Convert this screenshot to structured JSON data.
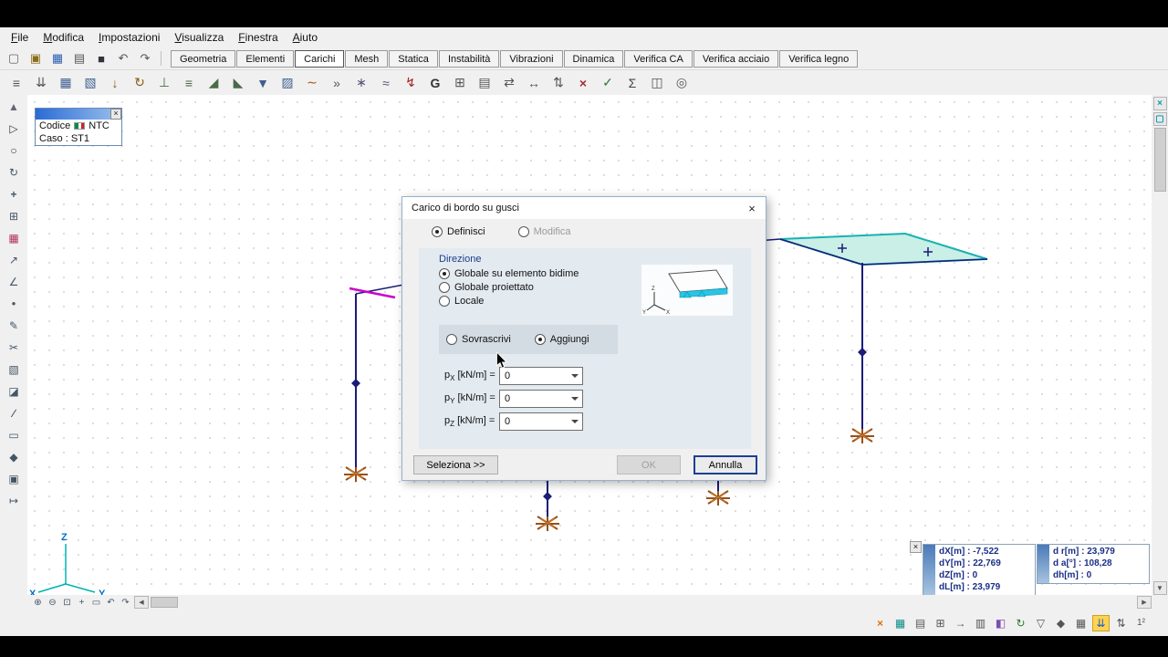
{
  "menu": {
    "items": [
      "File",
      "Modifica",
      "Impostazioni",
      "Visualizza",
      "Finestra",
      "Aiuto"
    ]
  },
  "toolbar1": {
    "icons": [
      {
        "name": "new-document-icon",
        "glyph": "▢",
        "style": "color:#666"
      },
      {
        "name": "open-folder-icon",
        "glyph": "▣",
        "style": "color:#8a6d1a"
      },
      {
        "name": "save-icon",
        "glyph": "▦",
        "style": "color:#2b5fb0"
      },
      {
        "name": "print-icon",
        "glyph": "▤",
        "style": "color:#555"
      },
      {
        "name": "snapshot-icon",
        "glyph": "■",
        "style": "color:#30343a"
      },
      {
        "name": "undo-icon",
        "glyph": "↶",
        "style": "color:#555"
      },
      {
        "name": "redo-icon",
        "glyph": "↷",
        "style": "color:#555"
      }
    ]
  },
  "tabs": [
    {
      "label": "Geometria"
    },
    {
      "label": "Elementi"
    },
    {
      "label": "Carichi",
      "active": true
    },
    {
      "label": "Mesh"
    },
    {
      "label": "Statica"
    },
    {
      "label": "Instabilità"
    },
    {
      "label": "Vibrazioni"
    },
    {
      "label": "Dinamica"
    },
    {
      "label": "Verifica CA"
    },
    {
      "label": "Verifica acciaio"
    },
    {
      "label": "Verifica legno"
    }
  ],
  "toolbar2": {
    "icons": [
      {
        "name": "load-list-icon",
        "glyph": "≡",
        "style": "color:#555"
      },
      {
        "name": "load-group-icon",
        "glyph": "⇊",
        "style": "color:#555"
      },
      {
        "name": "edge-load-icon",
        "glyph": "▦",
        "style": "color:#3f5f8f"
      },
      {
        "name": "surface-load-icon",
        "glyph": "▧",
        "style": "color:#3f5f8f"
      },
      {
        "name": "nodal-force-icon",
        "glyph": "↓",
        "style": "color:#8a5a10"
      },
      {
        "name": "nodal-moment-icon",
        "glyph": "↻",
        "style": "color:#8a5a10"
      },
      {
        "name": "beam-point-load-icon",
        "glyph": "⊥",
        "style": "color:#4a6a4a"
      },
      {
        "name": "beam-distributed-load-icon",
        "glyph": "≡",
        "style": "color:#4a6a4a"
      },
      {
        "name": "trapezoidal-load-icon",
        "glyph": "◢",
        "style": "color:#4a6a4a"
      },
      {
        "name": "triangular-load-icon",
        "glyph": "◣",
        "style": "color:#4a6a4a"
      },
      {
        "name": "pressure-load-icon",
        "glyph": "▼",
        "style": "color:#3f5f8f"
      },
      {
        "name": "shell-load-icon",
        "glyph": "▨",
        "style": "color:#3f5f8f"
      },
      {
        "name": "thermal-load-icon",
        "glyph": "∼",
        "style": "color:#b05010"
      },
      {
        "name": "prestress-load-icon",
        "glyph": "»",
        "style": "color:#555"
      },
      {
        "name": "snow-load-icon",
        "glyph": "∗",
        "style": "color:#555577"
      },
      {
        "name": "wind-load-icon",
        "glyph": "≈",
        "style": "color:#555577"
      },
      {
        "name": "seismic-load-icon",
        "glyph": "↯",
        "style": "color:#a02020"
      },
      {
        "name": "gravity-load-icon",
        "glyph": "G",
        "style": "color:#333;font-weight:bold"
      },
      {
        "name": "mass-load-icon",
        "glyph": "⊞",
        "style": "color:#555"
      },
      {
        "name": "load-table-icon",
        "glyph": "▤",
        "style": "color:#555"
      },
      {
        "name": "copy-loads-icon",
        "glyph": "⇄",
        "style": "color:#555"
      },
      {
        "name": "move-loads-icon",
        "glyph": "↔",
        "style": "color:#555"
      },
      {
        "name": "scale-loads-icon",
        "glyph": "⇅",
        "style": "color:#555"
      },
      {
        "name": "delete-loads-icon",
        "glyph": "×",
        "style": "color:#a03030;font-weight:bold"
      },
      {
        "name": "check-loads-icon",
        "glyph": "✓",
        "style": "color:#2a7a2a"
      },
      {
        "name": "sum-loads-icon",
        "glyph": "Σ",
        "style": "color:#444"
      },
      {
        "name": "view-loads-icon",
        "glyph": "◫",
        "style": "color:#555"
      },
      {
        "name": "loads-options-icon",
        "glyph": "◎",
        "style": "color:#555"
      }
    ]
  },
  "left_toolbar": {
    "icons": [
      {
        "name": "scroll-up-icon",
        "glyph": "▲",
        "style": "color:#667"
      },
      {
        "name": "select-pointer-icon",
        "glyph": "▷",
        "style": "color:#334"
      },
      {
        "name": "zoom-tool-icon",
        "glyph": "○",
        "style": "color:#334"
      },
      {
        "name": "rotate-view-icon",
        "glyph": "↻",
        "style": "color:#445566"
      },
      {
        "name": "pan-tool-icon",
        "glyph": "+",
        "style": "color:#445566;font-weight:bold"
      },
      {
        "name": "copy-tool-icon",
        "glyph": "⊞",
        "style": "color:#445566"
      },
      {
        "name": "color-map-icon",
        "glyph": "▦",
        "style": "color:#b03060"
      },
      {
        "name": "measure-tool-icon",
        "glyph": "↗",
        "style": "color:#445566"
      },
      {
        "name": "angle-tool-icon",
        "glyph": "∠",
        "style": "color:#445566"
      },
      {
        "name": "node-tool-icon",
        "glyph": "●",
        "style": "color:#445566;font-size:8px"
      },
      {
        "name": "edit-tool-icon",
        "glyph": "✎",
        "style": "color:#445566"
      },
      {
        "name": "cut-tool-icon",
        "glyph": "✂",
        "style": "color:#445566"
      },
      {
        "name": "mesh-tool-icon",
        "glyph": "▧",
        "style": "color:#445566"
      },
      {
        "name": "section-tool-icon",
        "glyph": "◪",
        "style": "color:#445566"
      },
      {
        "name": "polyline-tool-icon",
        "glyph": "∕",
        "style": "color:#445566;font-weight:bold"
      },
      {
        "name": "rect-tool-icon",
        "glyph": "▭",
        "style": "color:#445566"
      },
      {
        "name": "diamond-tool-icon",
        "glyph": "◆",
        "style": "color:#445566"
      },
      {
        "name": "grid-tool-icon",
        "glyph": "▣",
        "style": "color:#445566"
      },
      {
        "name": "ruler-tool-icon",
        "glyph": "↦",
        "style": "color:#445566"
      }
    ]
  },
  "code_panel": {
    "close_glyph": "×",
    "code_label": "Codice",
    "code_value": "NTC",
    "case_text": "Caso : ST1"
  },
  "axis": {
    "x": "X",
    "y": "Y",
    "z": "Z"
  },
  "dialog": {
    "title": "Carico di bordo su gusci",
    "close_glyph": "×",
    "mode_options": [
      {
        "label": "Definisci",
        "checked": true
      },
      {
        "label": "Modifica",
        "disabled": true
      }
    ],
    "direction_label": "Direzione",
    "direction_options": [
      {
        "label": "Globale su elemento bidime",
        "checked": true
      },
      {
        "label": "Globale proiettato"
      },
      {
        "label": "Locale"
      }
    ],
    "apply_options": [
      {
        "label": "Sovrascrivi"
      },
      {
        "label": "Aggiungi",
        "checked": true
      }
    ],
    "fields": [
      {
        "sym": "p",
        "sub": "X",
        "unit": "[kN/m] =",
        "value": "0"
      },
      {
        "sym": "p",
        "sub": "Y",
        "unit": "[kN/m] =",
        "value": "0"
      },
      {
        "sym": "p",
        "sub": "Z",
        "unit": "[kN/m] =",
        "value": "0"
      }
    ],
    "select_button": "Seleziona >>",
    "ok_button": "OK",
    "cancel_button": "Annulla"
  },
  "coords": {
    "close_glyph": "×",
    "panel1_rows": [
      "dX[m] : -7,522",
      "dY[m] : 22,769",
      "dZ[m] : 0",
      "dL[m] : 23,979"
    ],
    "panel2_rows": [
      "d r[m] : 23,979",
      "d a[°] : 108,28",
      "dh[m] : 0"
    ]
  },
  "nav_icons": [
    {
      "name": "zoom-in-icon",
      "glyph": "⊕"
    },
    {
      "name": "zoom-out-icon",
      "glyph": "⊖"
    },
    {
      "name": "zoom-extents-icon",
      "glyph": "⊡"
    },
    {
      "name": "pan-view-icon",
      "glyph": "+"
    },
    {
      "name": "zoom-window-icon",
      "glyph": "▭"
    },
    {
      "name": "previous-view-icon",
      "glyph": "↶"
    },
    {
      "name": "next-view-icon",
      "glyph": "↷"
    }
  ],
  "status_icons": [
    {
      "name": "clear-selection-icon",
      "glyph": "×",
      "style": "color:#e07000;font-weight:bold"
    },
    {
      "name": "table-view-icon",
      "glyph": "▦",
      "style": "color:#0a8a8a"
    },
    {
      "name": "list-view-icon",
      "glyph": "▤",
      "style": "color:#555"
    },
    {
      "name": "grid-view-icon",
      "glyph": "⊞",
      "style": "color:#555"
    },
    {
      "name": "export-icon",
      "glyph": "→",
      "style": "color:#555"
    },
    {
      "name": "report-icon",
      "glyph": "▥",
      "style": "color:#555"
    },
    {
      "name": "layers-icon",
      "glyph": "◧",
      "style": "color:#7a4fae"
    },
    {
      "name": "refresh-icon",
      "glyph": "↻",
      "style": "color:#2a7a2a"
    },
    {
      "name": "filter-icon",
      "glyph": "▽",
      "style": "color:#555"
    },
    {
      "name": "snap-icon",
      "glyph": "◆",
      "style": "color:#555"
    },
    {
      "name": "display-grid-icon",
      "glyph": "▦",
      "style": "color:#555"
    },
    {
      "name": "sort-descending-icon",
      "glyph": "⇊",
      "style": "color:#1c5fd0;background:#ffd34d;border:1px solid #c9a227"
    },
    {
      "name": "sort-toggle-icon",
      "glyph": "⇅",
      "style": "color:#555"
    },
    {
      "name": "numbering-icon",
      "glyph": "1²",
      "style": "color:#555;font-size:10px"
    }
  ],
  "scrollbar": {
    "up": "▲",
    "down": "▼",
    "left": "◀",
    "right": "▶",
    "close": "×",
    "restore": "▢"
  },
  "colors": {
    "structure_navy": "#1b1b78",
    "slab_teal": "#18b2b2",
    "selection_magenta": "#cc00cc",
    "support_brown": "#9a4f16",
    "axis_cyan": "#00b3b3",
    "status_orange": "#e07000"
  }
}
